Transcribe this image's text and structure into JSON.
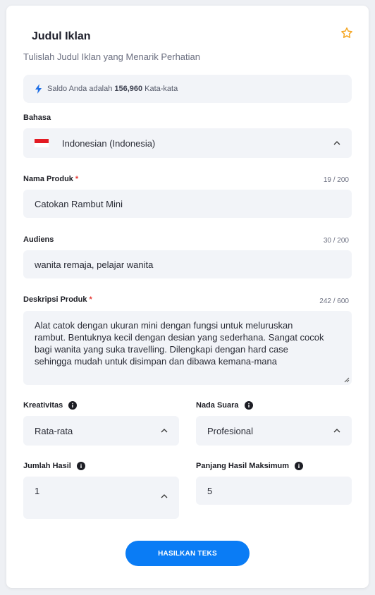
{
  "form": {
    "title": "Judul Iklan",
    "subtitle": "Tulislah Judul Iklan yang Menarik Perhatian",
    "star_icon": "star-outline-icon",
    "accent_color": "#0a7cf5",
    "star_color": "#f5a623"
  },
  "balance": {
    "prefix": "Saldo Anda adalah",
    "amount": "156,960",
    "suffix": "Kata-kata",
    "icon": "lightning-bolt-icon"
  },
  "language": {
    "label": "Bahasa",
    "value": "Indonesian (Indonesia)",
    "flag_icon": "indonesia-flag-icon"
  },
  "product_name": {
    "label": "Nama Produk",
    "required_mark": "*",
    "counter": "19 / 200",
    "value": "Catokan Rambut Mini"
  },
  "audience": {
    "label": "Audiens",
    "counter": "30 / 200",
    "value": "wanita remaja,  pelajar wanita"
  },
  "description": {
    "label": "Deskripsi Produk",
    "required_mark": "*",
    "counter": "242 / 600",
    "lines": [
      "Alat catok dengan ukuran mini dengan fungsi untuk meluruskan",
      "rambut. Bentuknya kecil dengan desian yang sederhana. Sangat cocok",
      "bagi wanita yang suka travelling. Dilengkapi dengan hard case",
      "sehingga mudah untuk disimpan dan dibawa kemana-mana"
    ]
  },
  "creativity": {
    "label": "Kreativitas",
    "value": "Rata-rata"
  },
  "tone": {
    "label": "Nada Suara",
    "value": "Profesional"
  },
  "result_count": {
    "label": "Jumlah Hasil",
    "value": "1"
  },
  "max_length": {
    "label": "Panjang Hasil Maksimum",
    "value": "5"
  },
  "submit": {
    "label": "HASILKAN TEKS"
  }
}
